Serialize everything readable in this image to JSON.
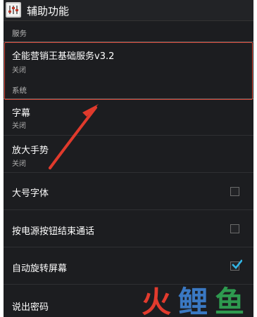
{
  "action_bar": {
    "title": "辅助功能",
    "icon": "app-settings-icon"
  },
  "sections": {
    "services": {
      "label": "服务"
    },
    "system": {
      "label": "系统"
    }
  },
  "services_items": [
    {
      "title": "全能营销王基础服务v3.2",
      "summary": "关闭"
    }
  ],
  "system_items": [
    {
      "title": "字幕",
      "summary": "关闭"
    },
    {
      "title": "放大手势",
      "summary": "关闭"
    },
    {
      "title": "大号字体",
      "checked": false
    },
    {
      "title": "按电源按钮结束通话",
      "checked": false
    },
    {
      "title": "自动旋转屏幕",
      "checked": true
    },
    {
      "title": "说出密码"
    }
  ],
  "annotation": {
    "arrow_color": "#d64a3b",
    "box_color": "#d64a3b"
  },
  "watermark": {
    "text": "火鲤鱼",
    "colors": [
      "#e23b2e",
      "#3a78c2",
      "#2e9a4f"
    ]
  },
  "theme": {
    "background": "#1c1d20",
    "accent": "#33b5e5"
  }
}
